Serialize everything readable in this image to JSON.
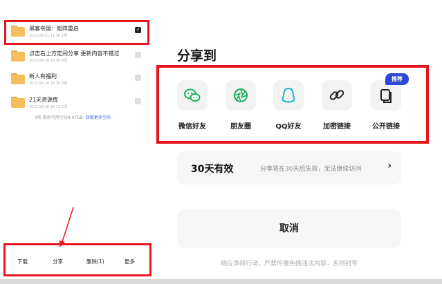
{
  "files": [
    {
      "name": "黑客帝国：矩阵重启",
      "meta": "2022-06-21 11:36  1项",
      "checked": true
    },
    {
      "name": "点击右上方定间分享 更新内容不错过",
      "meta": "2022-06-18 18:30  0项",
      "checked": false
    },
    {
      "name": "新人有福利",
      "meta": "2022-06-18 18:30  0项",
      "checked": false
    },
    {
      "name": "21天资源库",
      "meta": "2022-06-18 18:13  0项",
      "checked": false
    }
  ],
  "storage": {
    "text": "4项 剩余可用空间4.07GB",
    "link": "获取更多空间"
  },
  "bottom_actions": [
    "下载",
    "分享",
    "删除(1)",
    "更多"
  ],
  "share": {
    "title": "分享到",
    "options": [
      {
        "label": "微信好友",
        "icon": "wechat-icon"
      },
      {
        "label": "朋友圈",
        "icon": "moments-icon"
      },
      {
        "label": "QQ好友",
        "icon": "qq-icon"
      },
      {
        "label": "加密链接",
        "icon": "link-icon"
      },
      {
        "label": "公开链接",
        "icon": "copy-icon"
      }
    ],
    "badge": "推荐",
    "validity": {
      "days": "30天有效",
      "note": "分享将在30天后失效，无法继续访问"
    },
    "cancel": "取消",
    "footer": "响应净网行动，严禁传播色情违法内容，否则封号"
  },
  "colors": {
    "highlight": "#e6151d",
    "accent": "#2f46d6",
    "green": "#1aad5a",
    "cyan": "#17b5c8"
  }
}
